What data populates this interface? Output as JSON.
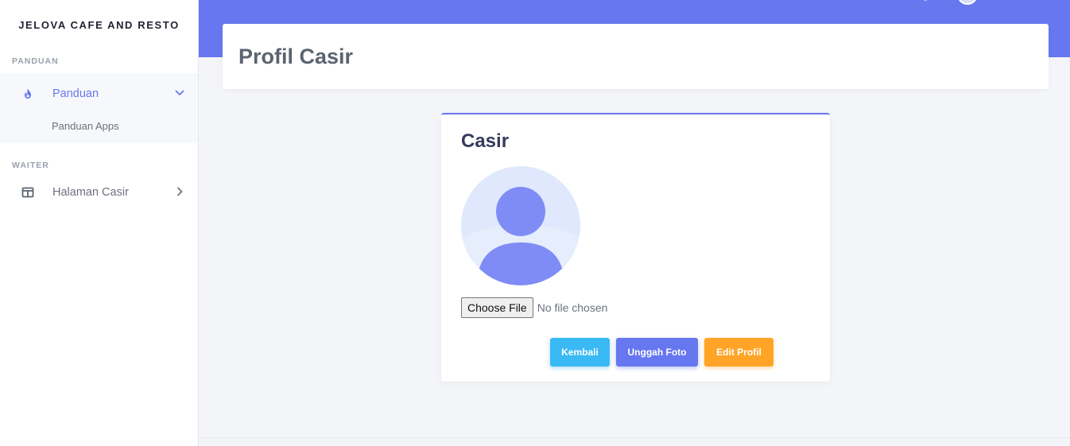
{
  "brand": "JELOVA CAFE AND RESTO",
  "sidebar": {
    "sections": [
      {
        "label": "PANDUAN",
        "items": [
          {
            "label": "Panduan",
            "icon": "fire-icon",
            "active": true,
            "expanded": true,
            "subitems": [
              {
                "label": "Panduan Apps"
              }
            ]
          }
        ]
      },
      {
        "label": "WAITER",
        "items": [
          {
            "label": "Halaman Casir",
            "icon": "columns-icon",
            "active": false,
            "expanded": false
          }
        ]
      }
    ]
  },
  "page": {
    "title": "Profil Casir"
  },
  "profile": {
    "name": "Casir",
    "avatar_icon": "user-avatar-icon",
    "file_input": {
      "button_label": "Choose File",
      "status": "No file chosen"
    },
    "buttons": {
      "back": "Kembali",
      "upload": "Unggah Foto",
      "edit": "Edit Profil"
    }
  },
  "colors": {
    "primary": "#6777ef",
    "info": "#3abaf4",
    "warning": "#ffa426",
    "background": "#f4f5f8"
  }
}
